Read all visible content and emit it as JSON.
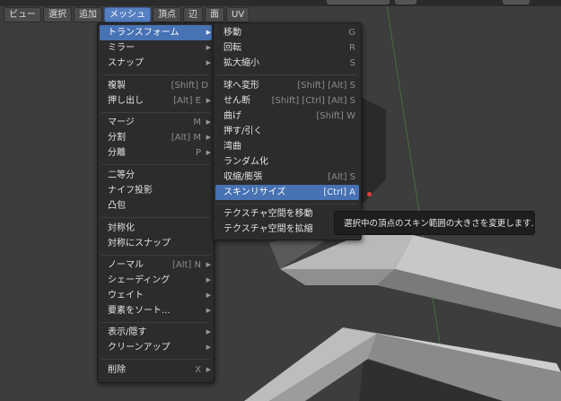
{
  "header_menu": [
    {
      "label": "ビュー"
    },
    {
      "label": "選択"
    },
    {
      "label": "追加"
    },
    {
      "label": "メッシュ",
      "active": true
    },
    {
      "label": "頂点"
    },
    {
      "label": "辺"
    },
    {
      "label": "面"
    },
    {
      "label": "UV"
    }
  ],
  "mesh_menu": {
    "items": [
      {
        "label": "トランスフォーム",
        "shortcut": "",
        "submenu": true,
        "highlighted": true
      },
      {
        "label": "ミラー",
        "shortcut": "",
        "submenu": true
      },
      {
        "label": "スナップ",
        "shortcut": "",
        "submenu": true
      },
      {
        "label": "複製",
        "shortcut": "[Shift] D",
        "submenu": false
      },
      {
        "label": "押し出し",
        "shortcut": "[Alt] E",
        "submenu": true
      },
      {
        "label": "マージ",
        "shortcut": "M",
        "submenu": true
      },
      {
        "label": "分割",
        "shortcut": "[Alt] M",
        "submenu": true
      },
      {
        "label": "分離",
        "shortcut": "P",
        "submenu": true
      },
      {
        "label": "二等分",
        "shortcut": "",
        "submenu": false
      },
      {
        "label": "ナイフ投影",
        "shortcut": "",
        "submenu": false
      },
      {
        "label": "凸包",
        "shortcut": "",
        "submenu": false
      },
      {
        "label": "対称化",
        "shortcut": "",
        "submenu": false
      },
      {
        "label": "対称にスナップ",
        "shortcut": "",
        "submenu": false
      },
      {
        "label": "ノーマル",
        "shortcut": "[Alt] N",
        "submenu": true
      },
      {
        "label": "シェーディング",
        "shortcut": "",
        "submenu": true
      },
      {
        "label": "ウェイト",
        "shortcut": "",
        "submenu": true
      },
      {
        "label": "要素をソート...",
        "shortcut": "",
        "submenu": true
      },
      {
        "label": "表示/隠す",
        "shortcut": "",
        "submenu": true
      },
      {
        "label": "クリーンアップ",
        "shortcut": "",
        "submenu": true
      },
      {
        "label": "削除",
        "shortcut": "X",
        "submenu": true
      }
    ]
  },
  "transform_submenu": {
    "items": [
      {
        "label": "移動",
        "shortcut": "G"
      },
      {
        "label": "回転",
        "shortcut": "R"
      },
      {
        "label": "拡大縮小",
        "shortcut": "S"
      },
      {
        "label": "球へ変形",
        "shortcut": "[Shift] [Alt] S"
      },
      {
        "label": "せん断",
        "shortcut": "[Shift] [Ctrl] [Alt] S"
      },
      {
        "label": "曲げ",
        "shortcut": "[Shift] W"
      },
      {
        "label": "押す/引く",
        "shortcut": ""
      },
      {
        "label": "湾曲",
        "shortcut": ""
      },
      {
        "label": "ランダム化",
        "shortcut": ""
      },
      {
        "label": "収縮/膨張",
        "shortcut": "[Alt] S"
      },
      {
        "label": "スキンリサイズ",
        "shortcut": "[Ctrl] A",
        "highlighted": true
      },
      {
        "label": "テクスチャ空間を移動",
        "shortcut": ""
      },
      {
        "label": "テクスチャ空間を拡縮",
        "shortcut": ""
      }
    ]
  },
  "tooltip": {
    "text": "選択中の頂点のスキン範囲の大きさを変更します."
  },
  "colors": {
    "highlight": "#4772b3",
    "menu_bg": "#2c2c2c",
    "viewport_bg": "#3d3d3d",
    "cursor": "#e04040"
  }
}
